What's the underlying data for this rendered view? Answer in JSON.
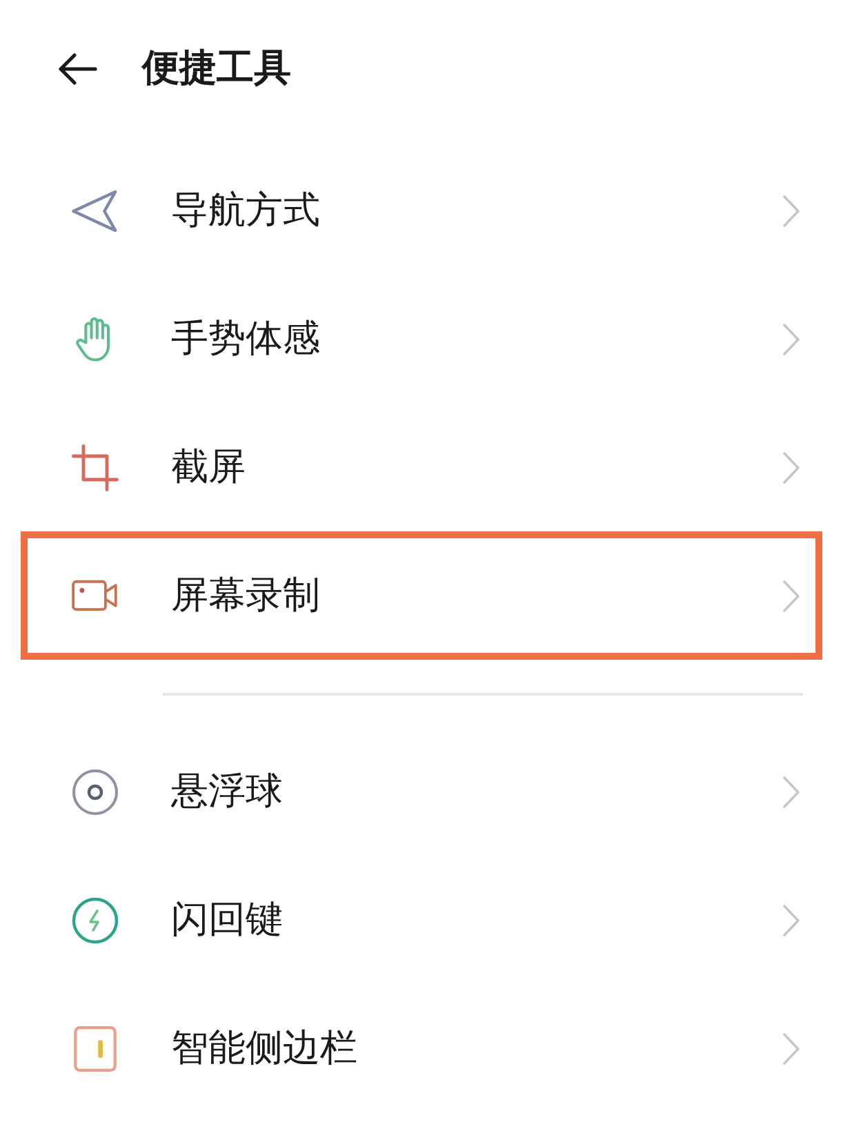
{
  "header": {
    "title": "便捷工具"
  },
  "sections": [
    {
      "items": [
        {
          "label": "导航方式",
          "kind": "navigation",
          "highlighted": false
        },
        {
          "label": "手势体感",
          "kind": "gesture",
          "highlighted": false
        },
        {
          "label": "截屏",
          "kind": "screenshot",
          "highlighted": false
        },
        {
          "label": "屏幕录制",
          "kind": "record",
          "highlighted": true
        }
      ]
    },
    {
      "items": [
        {
          "label": "悬浮球",
          "kind": "ball",
          "highlighted": false
        },
        {
          "label": "闪回键",
          "kind": "flashback",
          "highlighted": false
        },
        {
          "label": "智能侧边栏",
          "kind": "sidebar",
          "highlighted": false
        }
      ]
    }
  ]
}
